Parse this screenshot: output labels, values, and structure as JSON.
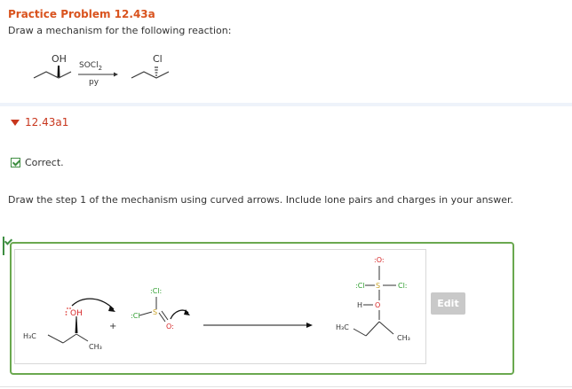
{
  "problem": {
    "title": "Practice Problem 12.43a",
    "prompt": "Draw a mechanism for the following reaction:",
    "reaction": {
      "reactant_label": "OH",
      "reagent_top": "SOCl",
      "reagent_top_sub": "2",
      "reagent_bottom": "py",
      "product_label": "Cl"
    }
  },
  "section": {
    "title": "12.43a1",
    "status": "Correct."
  },
  "question": "Draw the step 1 of the mechanism using curved arrows. Include lone pairs and charges in your answer.",
  "answer": {
    "reactant_oh": "OH",
    "reactant_h3c": "H₃C",
    "reactant_ch3": "CH₃",
    "plus": "+",
    "socl2_cl_top": ":Cl:",
    "socl2_cl_left": ":Cl",
    "socl2_s": "S",
    "socl2_o": "O:",
    "product_o_top": ":O:",
    "product_cl_left": ":Cl",
    "product_s": "S",
    "product_cl_right": "Cl:",
    "product_h": "H",
    "product_o": "O",
    "product_h3c": "H₃C",
    "product_ch3": "CH₃",
    "edit_label": "Edit"
  },
  "colors": {
    "title": "#d9531e",
    "section": "#c8361d",
    "correct_border": "#6aa84f",
    "atom_green": "#2e9e2e",
    "atom_red": "#d62728",
    "lone_pair_red": "#e0463f"
  }
}
